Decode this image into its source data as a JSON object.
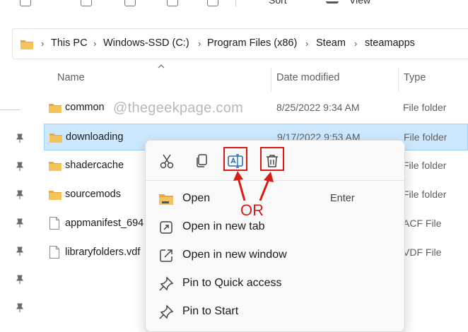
{
  "toolbar": {
    "sort_label": "Sort",
    "view_label": "View"
  },
  "address": {
    "crumbs": [
      "This PC",
      "Windows-SSD (C:)",
      "Program Files (x86)",
      "Steam",
      "steamapps"
    ]
  },
  "columns": {
    "name": "Name",
    "date": "Date modified",
    "type": "Type"
  },
  "watermark": "@thegeekpage.com",
  "files": [
    {
      "name": "common",
      "date": "8/25/2022 9:34 AM",
      "type": "File folder",
      "kind": "folder"
    },
    {
      "name": "downloading",
      "date": "9/17/2022 9:53 AM",
      "type": "File folder",
      "kind": "folder",
      "selected": true
    },
    {
      "name": "shadercache",
      "date": "",
      "type": "File folder",
      "kind": "folder"
    },
    {
      "name": "sourcemods",
      "date": "",
      "type": "File folder",
      "kind": "folder"
    },
    {
      "name": "appmanifest_694",
      "date": "",
      "type": "ACF File",
      "kind": "file"
    },
    {
      "name": "libraryfolders.vdf",
      "date": "",
      "type": "VDF File",
      "kind": "file"
    }
  ],
  "context_menu": {
    "quick_actions": [
      "cut-icon",
      "copy-icon",
      "rename-icon",
      "delete-icon"
    ],
    "items": [
      {
        "label": "Open",
        "shortcut": "Enter",
        "icon": "folder-icon"
      },
      {
        "label": "Open in new tab",
        "shortcut": "",
        "icon": "new-tab-icon"
      },
      {
        "label": "Open in new window",
        "shortcut": "",
        "icon": "new-window-icon"
      },
      {
        "label": "Pin to Quick access",
        "shortcut": "",
        "icon": "pin-icon"
      },
      {
        "label": "Pin to Start",
        "shortcut": "",
        "icon": "pin-icon"
      }
    ]
  },
  "annotation": {
    "or_label": "OR",
    "color": "#d81b14"
  },
  "colors": {
    "selection": "#cce8ff",
    "folder": "#e8a93c"
  }
}
